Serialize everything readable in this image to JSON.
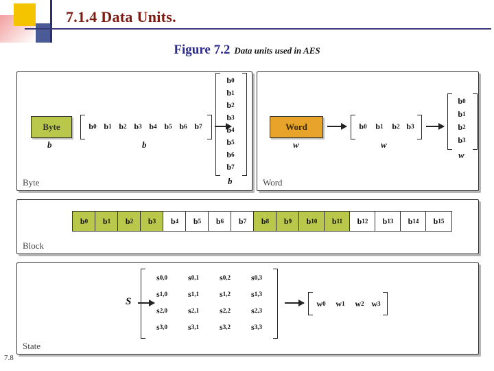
{
  "header": {
    "title": "7.1.4  Data Units.",
    "figure_number": "Figure 7.2",
    "figure_caption": "Data units used in AES"
  },
  "slide_number": "7.8",
  "panels": {
    "byte": {
      "label": "Byte",
      "box_label": "Byte",
      "box_sub": "b",
      "row_cells": [
        "b0",
        "b1",
        "b2",
        "b3",
        "b4",
        "b5",
        "b6",
        "b7"
      ],
      "row_sub": "b",
      "col_cells": [
        "b0",
        "b1",
        "b2",
        "b3",
        "b4",
        "b5",
        "b6",
        "b7"
      ],
      "col_sub": "b"
    },
    "word": {
      "label": "Word",
      "box_label": "Word",
      "box_sub": "w",
      "row_cells": [
        "b0",
        "b1",
        "b2",
        "b3"
      ],
      "row_sub": "w",
      "col_cells": [
        "b0",
        "b1",
        "b2",
        "b3"
      ],
      "col_sub": "w"
    },
    "block": {
      "label": "Block",
      "cells": [
        "b0",
        "b1",
        "b2",
        "b3",
        "b4",
        "b5",
        "b6",
        "b7",
        "b8",
        "b9",
        "b10",
        "b11",
        "b12",
        "b13",
        "b14",
        "b15"
      ],
      "highlighted": [
        "b0",
        "b1",
        "b2",
        "b3",
        "b8",
        "b9",
        "b10",
        "b11"
      ]
    },
    "state": {
      "label": "State",
      "name": "S",
      "matrix": [
        [
          "s0,0",
          "s0,1",
          "s0,2",
          "s0,3"
        ],
        [
          "s1,0",
          "s1,1",
          "s1,2",
          "s1,3"
        ],
        [
          "s2,0",
          "s2,1",
          "s2,2",
          "s2,3"
        ],
        [
          "s3,0",
          "s3,1",
          "s3,2",
          "s3,3"
        ]
      ],
      "words": [
        "w0",
        "w1",
        "w2",
        "w3"
      ]
    }
  },
  "colors": {
    "title": "#7b1b12",
    "figure_number": "#2b2b8c",
    "byte_fill": "#b9c74a",
    "word_fill": "#e8a32a",
    "rule": "#3a3a7a"
  }
}
